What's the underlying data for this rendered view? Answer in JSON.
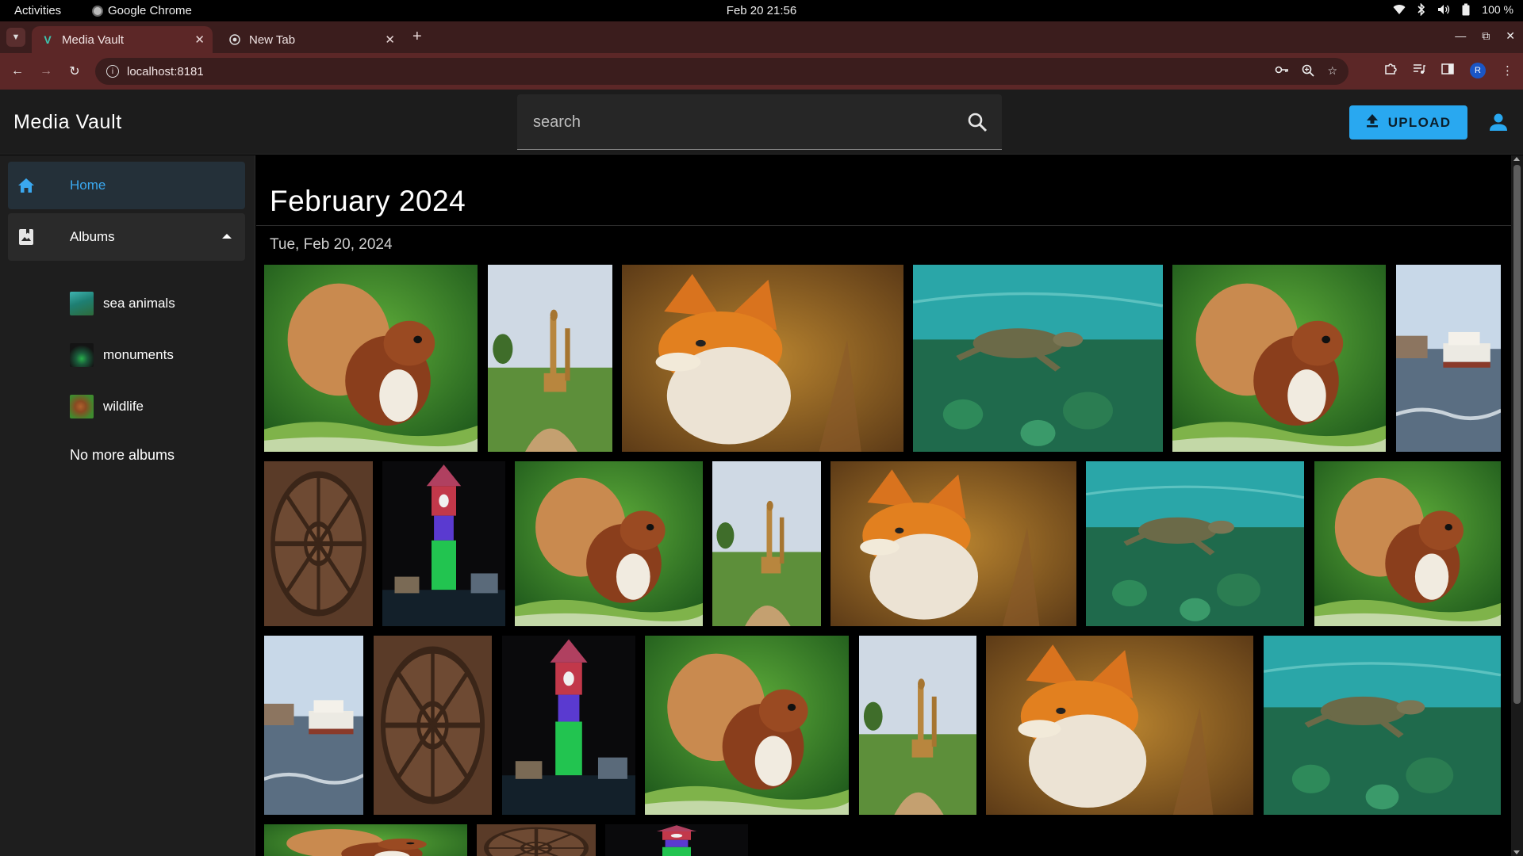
{
  "os": {
    "activities": "Activities",
    "app_name": "Google Chrome",
    "clock": "Feb 20  21:56",
    "battery": "100 %"
  },
  "browser": {
    "tabs": [
      {
        "title": "Media Vault",
        "active": true,
        "favicon": "V"
      },
      {
        "title": "New Tab",
        "active": false
      }
    ],
    "url": "localhost:8181",
    "profile_initial": "R"
  },
  "app": {
    "title": "Media Vault",
    "search_placeholder": "search",
    "upload_label": "UPLOAD"
  },
  "sidebar": {
    "home_label": "Home",
    "albums_label": "Albums",
    "albums": [
      {
        "name": "sea animals",
        "thumb": "turtle"
      },
      {
        "name": "monuments",
        "thumb": "tower"
      },
      {
        "name": "wildlife",
        "thumb": "squirrel"
      }
    ],
    "no_more_label": "No more albums"
  },
  "gallery": {
    "month_title": "February 2024",
    "day_title": "Tue, Feb 20, 2024",
    "photos": [
      "squirrel",
      "giraffe",
      "fox",
      "turtle",
      "squirrel",
      "ferry",
      "wheel",
      "tower",
      "squirrel",
      "giraffe",
      "fox",
      "turtle",
      "squirrel",
      "ferry",
      "wheel",
      "tower",
      "squirrel",
      "giraffe",
      "fox",
      "turtle",
      "squirrel",
      "wheel",
      "tower"
    ]
  },
  "colors": {
    "accent": "#29a8f0",
    "tab_strip": "#3b1d1d",
    "toolbar": "#5c2727",
    "header": "#1c1c1c",
    "sidebar": "#1e1e1e"
  }
}
